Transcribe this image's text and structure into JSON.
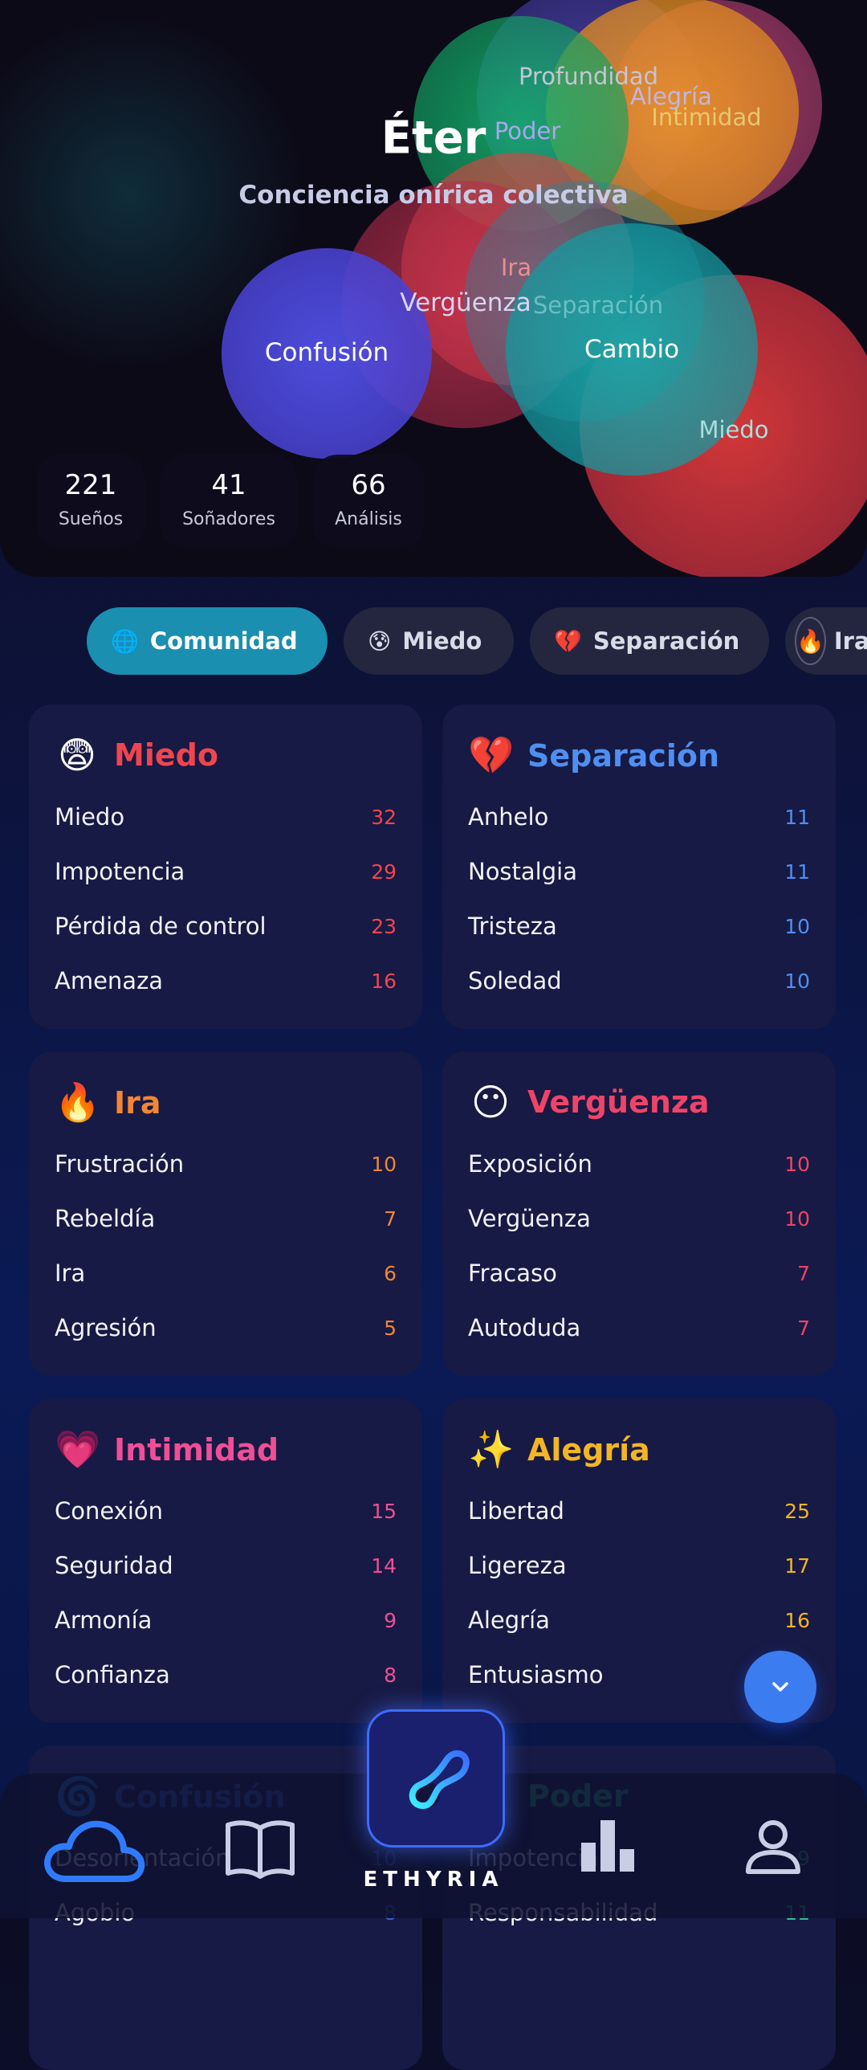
{
  "header": {
    "title": "Éter",
    "subtitle": "Conciencia onírica colectiva"
  },
  "bubbles": [
    {
      "label": "Profundidad"
    },
    {
      "label": "Alegría"
    },
    {
      "label": "Intimidad"
    },
    {
      "label": "Poder"
    },
    {
      "label": "Ira"
    },
    {
      "label": "Vergüenza"
    },
    {
      "label": "Separación"
    },
    {
      "label": "Cambio"
    },
    {
      "label": "Confusión"
    },
    {
      "label": "Miedo"
    }
  ],
  "stats": [
    {
      "value": "221",
      "label": "Sueños"
    },
    {
      "value": "41",
      "label": "Soñadores"
    },
    {
      "value": "66",
      "label": "Análisis"
    }
  ],
  "filters": [
    {
      "emoji": "🌐",
      "label": "Comunidad",
      "active": true
    },
    {
      "emoji": "😰",
      "label": "Miedo"
    },
    {
      "emoji": "💔",
      "label": "Separación"
    },
    {
      "emoji": "🔥",
      "label": "Ira"
    }
  ],
  "categories": [
    {
      "emoji": "😨",
      "title": "Miedo",
      "color": "#f0454f",
      "items": [
        {
          "label": "Miedo",
          "count": "32"
        },
        {
          "label": "Impotencia",
          "count": "29"
        },
        {
          "label": "Pérdida de control",
          "count": "23"
        },
        {
          "label": "Amenaza",
          "count": "16"
        }
      ]
    },
    {
      "emoji": "💔",
      "title": "Separación",
      "color": "#4f8ff2",
      "items": [
        {
          "label": "Anhelo",
          "count": "11"
        },
        {
          "label": "Nostalgia",
          "count": "11"
        },
        {
          "label": "Tristeza",
          "count": "10"
        },
        {
          "label": "Soledad",
          "count": "10"
        }
      ]
    },
    {
      "emoji": "🔥",
      "title": "Ira",
      "color": "#f08636",
      "items": [
        {
          "label": "Frustración",
          "count": "10"
        },
        {
          "label": "Rebeldía",
          "count": "7"
        },
        {
          "label": "Ira",
          "count": "6"
        },
        {
          "label": "Agresión",
          "count": "5"
        }
      ]
    },
    {
      "emoji": "😶",
      "title": "Vergüenza",
      "color": "#ee4468",
      "items": [
        {
          "label": "Exposición",
          "count": "10"
        },
        {
          "label": "Vergüenza",
          "count": "10"
        },
        {
          "label": "Fracaso",
          "count": "7"
        },
        {
          "label": "Autoduda",
          "count": "7"
        }
      ]
    },
    {
      "emoji": "💗",
      "title": "Intimidad",
      "color": "#ee4f96",
      "items": [
        {
          "label": "Conexión",
          "count": "15"
        },
        {
          "label": "Seguridad",
          "count": "14"
        },
        {
          "label": "Armonía",
          "count": "9"
        },
        {
          "label": "Confianza",
          "count": "8"
        }
      ]
    },
    {
      "emoji": "✨",
      "title": "Alegría",
      "color": "#f2b525",
      "items": [
        {
          "label": "Libertad",
          "count": "25"
        },
        {
          "label": "Ligereza",
          "count": "17"
        },
        {
          "label": "Alegría",
          "count": "16"
        },
        {
          "label": "Entusiasmo",
          "count": ""
        }
      ]
    },
    {
      "emoji": "🌀",
      "title": "Confusión",
      "color": "#3a5fd8",
      "items": [
        {
          "label": "Desorientación",
          "count": "10"
        },
        {
          "label": "Agobio",
          "count": "8"
        }
      ]
    },
    {
      "emoji": "⚡",
      "title": "Poder",
      "color": "#2fbf8a",
      "items": [
        {
          "label": "Impotencia",
          "count": "9"
        },
        {
          "label": "Responsabilidad",
          "count": "11"
        }
      ]
    }
  ],
  "nav": {
    "brand": "ETHYRIA",
    "items": [
      {
        "icon": "cloud-icon"
      },
      {
        "icon": "book-icon"
      },
      {
        "icon": "bar-chart-icon"
      },
      {
        "icon": "user-icon"
      }
    ]
  }
}
